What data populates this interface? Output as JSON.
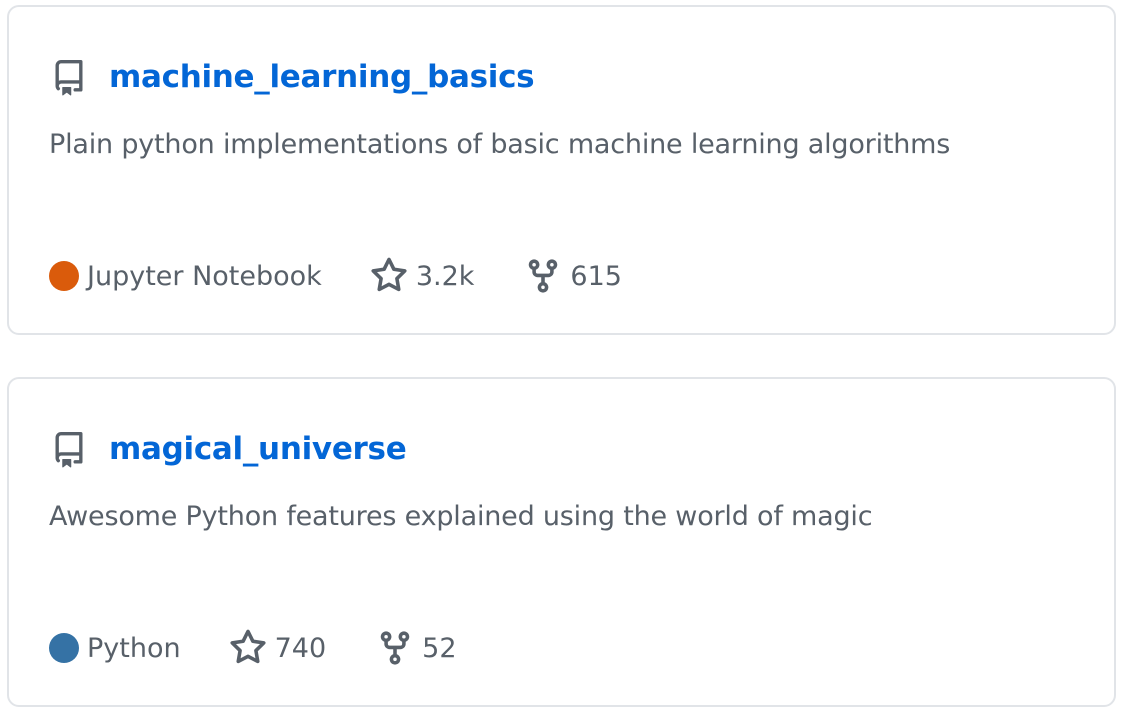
{
  "repos": [
    {
      "name": "machine_learning_basics",
      "description": "Plain python implementations of basic machine learning algorithms",
      "language": "Jupyter Notebook",
      "language_color": "#DA5B0B",
      "stars": "3.2k",
      "forks": "615",
      "icons": {
        "repo": "repo-icon",
        "star": "star-icon",
        "fork": "fork-icon"
      }
    },
    {
      "name": "magical_universe",
      "description": "Awesome Python features explained using the world of magic",
      "language": "Python",
      "language_color": "#3572A5",
      "stars": "740",
      "forks": "52",
      "icons": {
        "repo": "repo-icon",
        "star": "star-icon",
        "fork": "fork-icon"
      }
    }
  ],
  "colors": {
    "link": "#0366d6",
    "text_muted": "#586069",
    "border": "#e1e4e8"
  }
}
